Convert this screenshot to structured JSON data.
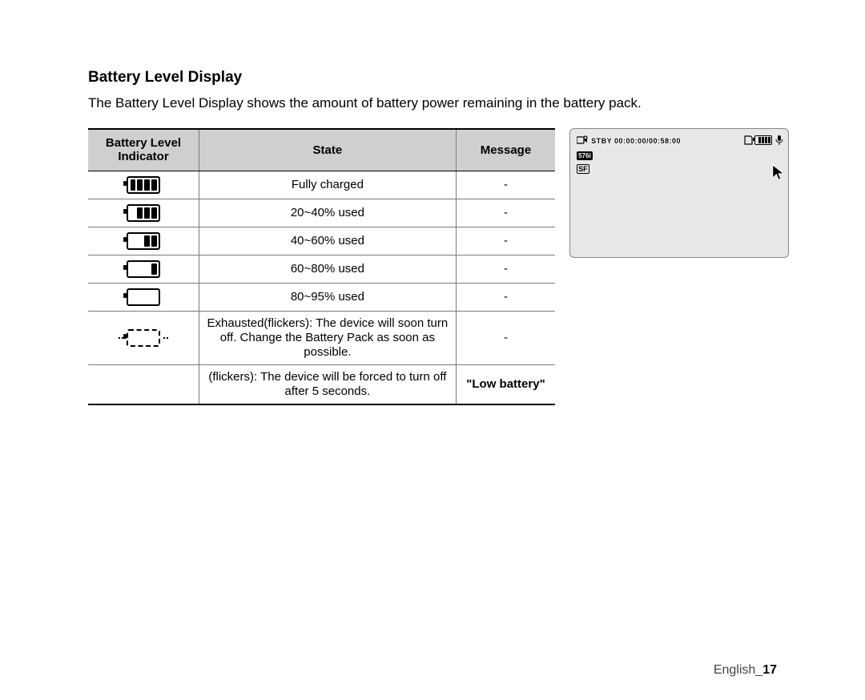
{
  "heading": "Battery Level Display",
  "intro": "The Battery Level Display shows the amount of battery power remaining in the battery pack.",
  "table": {
    "headers": {
      "indicator": "Battery Level Indicator",
      "state": "State",
      "message": "Message"
    },
    "rows": [
      {
        "bars": 4,
        "state": "Fully charged",
        "message": "-"
      },
      {
        "bars": 3,
        "state": "20~40% used",
        "message": "-"
      },
      {
        "bars": 2,
        "state": "40~60% used",
        "message": "-"
      },
      {
        "bars": 1,
        "state": "60~80% used",
        "message": "-"
      },
      {
        "bars": 0,
        "state": "80~95% used",
        "message": "-"
      },
      {
        "bars": 0,
        "flicker": true,
        "state": "Exhausted(flickers): The device will soon turn off. Change the Battery Pack as soon as possible.",
        "message": "-"
      },
      {
        "bars": 0,
        "empty_icon": true,
        "state": "(flickers): The device will be forced to turn off after 5 seconds.",
        "message": "\"Low battery\"",
        "message_bold": true
      }
    ]
  },
  "preview": {
    "stby_text": "STBY  00:00:00/00:58:00",
    "badge_576": "576i",
    "badge_sf": "SF"
  },
  "footer": {
    "lang": "English",
    "page": "17",
    "sep": "_"
  }
}
